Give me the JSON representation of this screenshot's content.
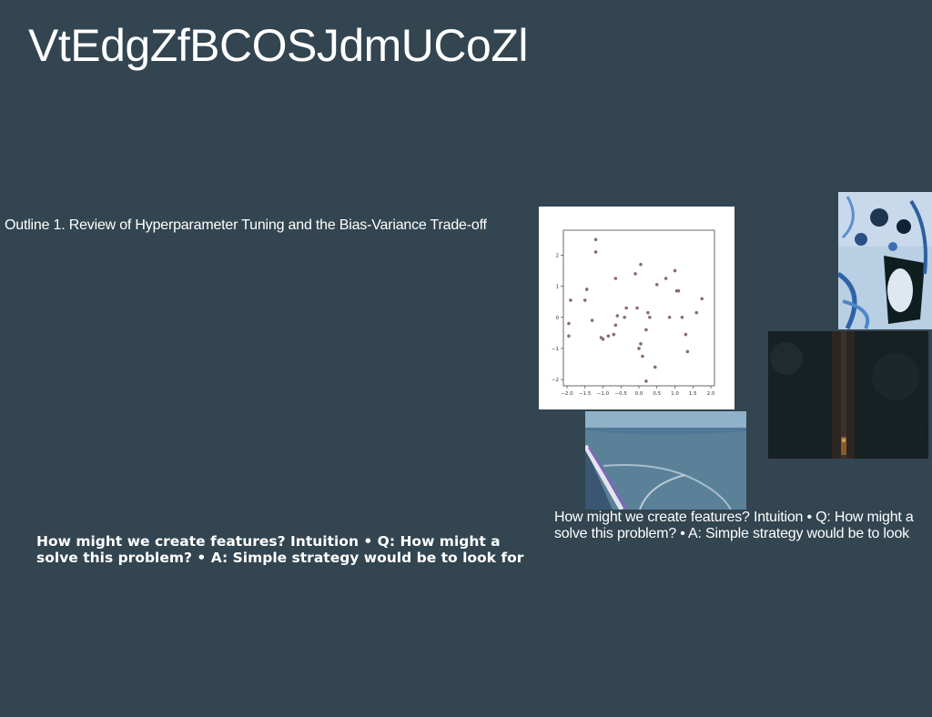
{
  "slide": {
    "title": "VtEdgZfBCOSJdmUCoZl",
    "outline_text": "Outline 1. Review of Hyperparameter Tuning and the Bias-Variance Trade-off",
    "caption_right": "How might we create features? Intuition • Q: How might a solve this problem? • A: Simple strategy would be to look",
    "caption_bold": "How might we create features? Intuition • Q: How might a solve this problem? • A: Simple strategy would be to look for"
  },
  "images": {
    "photo_a": "blue-ribbons-tabletop-photo",
    "photo_b": "dark-night-road-photo",
    "photo_c": "aerial-landscape-window-photo"
  },
  "chart_data": {
    "type": "scatter",
    "title": "",
    "xlabel": "",
    "ylabel": "",
    "xlim": [
      -2.1,
      2.1
    ],
    "ylim": [
      -2.2,
      2.8
    ],
    "xticks": [
      "−2.0",
      "−1.5",
      "−1.0",
      "−0.5",
      "0.0",
      "0.5",
      "1.0",
      "1.5",
      "2.0"
    ],
    "yticks": [
      "−2",
      "−1",
      "0",
      "1",
      "2"
    ],
    "point_color": "#8a6a78",
    "points": [
      [
        -1.95,
        -0.2
      ],
      [
        -1.95,
        -0.6
      ],
      [
        -1.9,
        0.55
      ],
      [
        -1.5,
        0.55
      ],
      [
        -1.45,
        0.9
      ],
      [
        -1.3,
        -0.1
      ],
      [
        -1.2,
        2.5
      ],
      [
        -1.2,
        2.1
      ],
      [
        -1.05,
        -0.65
      ],
      [
        -1.0,
        -0.7
      ],
      [
        -0.85,
        -0.6
      ],
      [
        -0.7,
        -0.55
      ],
      [
        -0.65,
        -0.25
      ],
      [
        -0.6,
        0.05
      ],
      [
        -0.65,
        1.25
      ],
      [
        -0.4,
        0.0
      ],
      [
        -0.35,
        0.3
      ],
      [
        -0.1,
        1.4
      ],
      [
        -0.05,
        0.3
      ],
      [
        0.05,
        1.7
      ],
      [
        0.0,
        -1.0
      ],
      [
        0.05,
        -0.85
      ],
      [
        0.1,
        -1.25
      ],
      [
        0.2,
        -0.4
      ],
      [
        0.25,
        0.15
      ],
      [
        0.3,
        0.0
      ],
      [
        0.2,
        -2.05
      ],
      [
        0.45,
        -1.6
      ],
      [
        0.5,
        1.05
      ],
      [
        0.75,
        1.25
      ],
      [
        0.85,
        0.0
      ],
      [
        1.0,
        1.5
      ],
      [
        1.05,
        0.85
      ],
      [
        1.1,
        0.85
      ],
      [
        1.2,
        0.0
      ],
      [
        1.3,
        -0.55
      ],
      [
        1.35,
        -1.1
      ],
      [
        1.6,
        0.15
      ],
      [
        1.75,
        0.6
      ]
    ]
  }
}
